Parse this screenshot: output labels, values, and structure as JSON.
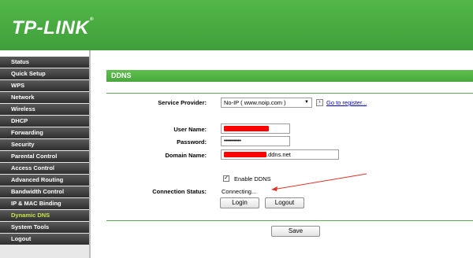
{
  "header": {
    "brand": "TP-LINK",
    "trademark": "®"
  },
  "sidebar": {
    "items": [
      {
        "label": "Status",
        "active": false
      },
      {
        "label": "Quick Setup",
        "active": false
      },
      {
        "label": "WPS",
        "active": false
      },
      {
        "label": "Network",
        "active": false
      },
      {
        "label": "Wireless",
        "active": false
      },
      {
        "label": "DHCP",
        "active": false
      },
      {
        "label": "Forwarding",
        "active": false
      },
      {
        "label": "Security",
        "active": false
      },
      {
        "label": "Parental Control",
        "active": false
      },
      {
        "label": "Access Control",
        "active": false
      },
      {
        "label": "Advanced Routing",
        "active": false
      },
      {
        "label": "Bandwidth Control",
        "active": false
      },
      {
        "label": "IP & MAC Binding",
        "active": false
      },
      {
        "label": "Dynamic DNS",
        "active": true
      },
      {
        "label": "System Tools",
        "active": false
      },
      {
        "label": "Logout",
        "active": false
      }
    ]
  },
  "main": {
    "section_title": "DDNS",
    "service_provider": {
      "label": "Service Provider:",
      "value": "No-IP ( www.noip.com )",
      "go_link": "Go to register..."
    },
    "username": {
      "label": "User Name:",
      "value": ""
    },
    "password": {
      "label": "Password:",
      "value": "•••••••••••"
    },
    "domain": {
      "label": "Domain Name:",
      "value_suffix": ".ddns.net"
    },
    "enable_ddns": {
      "label": "Enable DDNS",
      "checked": true
    },
    "connection_status": {
      "label": "Connection Status:",
      "value": "Connecting..."
    },
    "buttons": {
      "login": "Login",
      "logout": "Logout",
      "save": "Save"
    },
    "colors": {
      "accent_green": "#4caf3f",
      "redaction": "#ff0000",
      "annotation_arrow": "#e0302a"
    }
  }
}
